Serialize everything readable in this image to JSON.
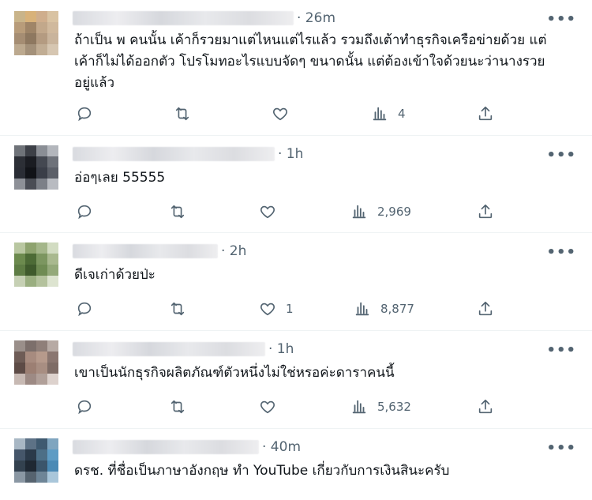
{
  "tweets": [
    {
      "time": "· 26m",
      "text": "ถ้าเป็น พ คนนั้น เค้าก็รวยมาแต่ไหนแต่ไรแล้ว รวมถึงเต้าทำธุรกิจเครือข่ายด้วย แต่เค้าก็ไม่ได้ออกตัว โปรโมทอะไรแบบจัดๆ ขนาดนั้น แต่ต้องเข้าใจด้วยนะว่านางรวยอยู่แล้ว",
      "reply_count": "",
      "retweet_count": "",
      "like_count": "",
      "view_count": "4"
    },
    {
      "time": "· 1h",
      "text": "อ่อๆเลย 55555",
      "reply_count": "",
      "retweet_count": "",
      "like_count": "",
      "view_count": "2,969"
    },
    {
      "time": "· 2h",
      "text": "ดีเจเก่าด้วยป่ะ",
      "reply_count": "",
      "retweet_count": "",
      "like_count": "1",
      "view_count": "8,877"
    },
    {
      "time": "· 1h",
      "text": "เขาเป็นนักธุรกิจผลิตภัณฑ์ตัวหนึ่งไม่ใช่หรอค่ะดาราคนนี้",
      "reply_count": "",
      "retweet_count": "",
      "like_count": "",
      "view_count": "5,632"
    },
    {
      "time": "· 40m",
      "text": "ดรช. ที่ชื่อเป็นภาษาอังกฤษ ทำ YouTube เกี่ยวกับการเงินสินะครับ",
      "reply_count": "",
      "retweet_count": "",
      "like_count": "",
      "view_count": ""
    }
  ],
  "ui": {
    "more_label": "•••",
    "icons": [
      "reply-icon",
      "retweet-icon",
      "like-icon",
      "views-icon",
      "share-icon"
    ]
  },
  "colors": {
    "muted": "#536471",
    "text": "#0f1419",
    "divider": "#eff3f4"
  }
}
